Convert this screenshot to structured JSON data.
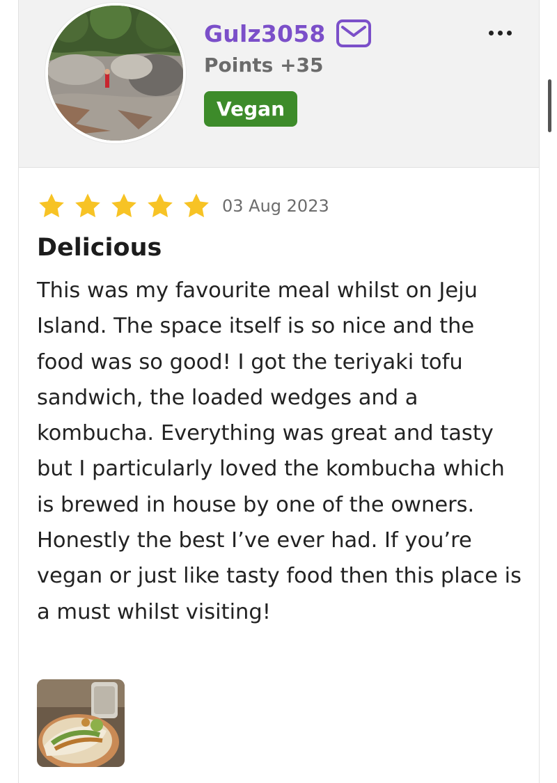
{
  "profile": {
    "username": "Gulz3058",
    "points": "Points +35",
    "badge": "Vegan",
    "avatar_icon": "user-avatar-photo",
    "message_icon": "mail-icon",
    "more_icon": "more-horizontal-icon"
  },
  "review": {
    "stars": 5,
    "date": "03 Aug 2023",
    "title": "Delicious",
    "body": "This was my favourite meal whilst on Jeju Island. The space itself is so nice and the food was so good! I got the teriyaki tofu sandwich, the loaded wedges and a kombucha. Everything was great and tasty but I particularly loved the kombucha which is brewed in house by one of the owners. Honestly the best I’ve ever had. If you’re vegan or just like tasty food then this place is a must whilst visiting!",
    "photo_icon": "food-photo-thumbnail"
  },
  "colors": {
    "username": "#7b4fc9",
    "badge_bg": "#3d8b2a",
    "star": "#f7c325",
    "header_bg": "#f2f2f2"
  }
}
